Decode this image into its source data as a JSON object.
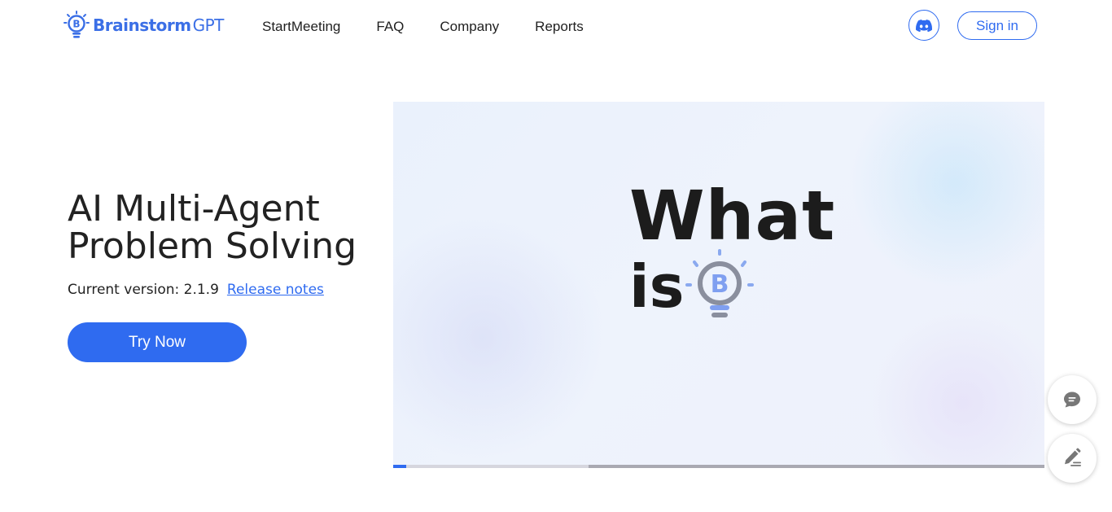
{
  "brand": {
    "name": "Brainstorm",
    "suffix": "GPT",
    "icon": "lightbulb-b-logo-icon",
    "color": "#3b6fe6"
  },
  "nav": {
    "items": [
      {
        "label": "StartMeeting"
      },
      {
        "label": "FAQ"
      },
      {
        "label": "Company"
      },
      {
        "label": "Reports"
      }
    ]
  },
  "header": {
    "discord_icon": "discord-icon",
    "signin_label": "Sign in",
    "accent": "#2f6bf0"
  },
  "hero": {
    "title_line1": "AI Multi-Agent",
    "title_line2": "Problem Solving",
    "version_text": "Current version: 2.1.9",
    "release_notes_label": "Release notes",
    "cta_label": "Try Now"
  },
  "video": {
    "headline_line1": "What",
    "headline_line2": "is",
    "logo_letter": "B",
    "progress_played": 0.02,
    "progress_buffered": 0.3
  },
  "floating": {
    "chat_icon": "chat-bubble-icon",
    "feedback_icon": "pencil-icon"
  }
}
